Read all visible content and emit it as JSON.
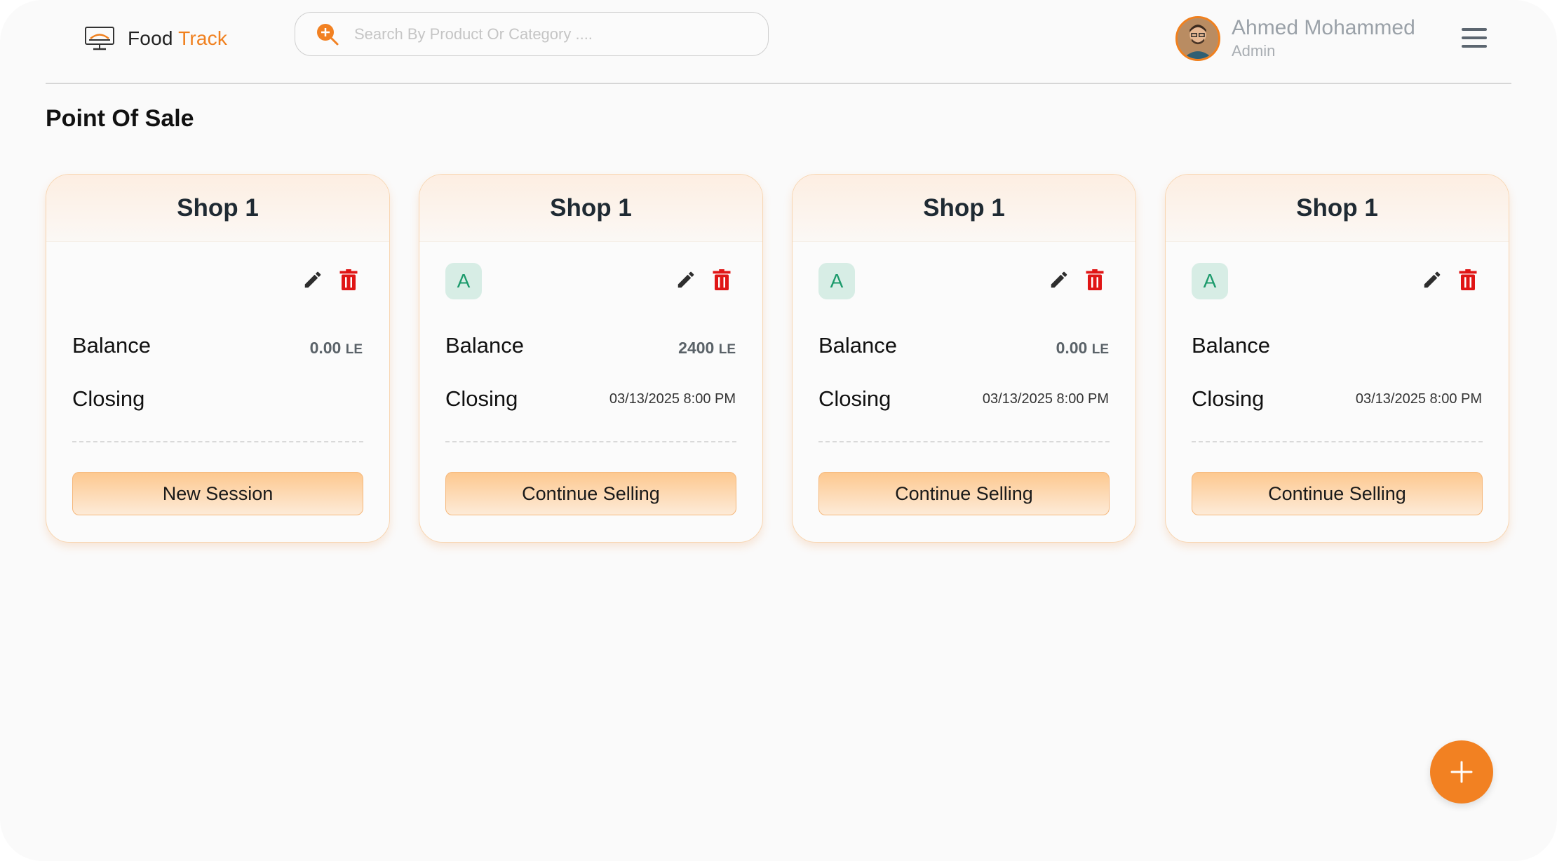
{
  "app": {
    "name_primary": "Food",
    "name_accent": "Track",
    "accent_color": "#f0801e"
  },
  "search": {
    "placeholder": "Search By Product Or Category ...."
  },
  "user": {
    "name": "Ahmed Mohammed",
    "role": "Admin"
  },
  "page": {
    "title": "Point Of Sale"
  },
  "shops": [
    {
      "title": "Shop 1",
      "badge": "",
      "balance_label": "Balance",
      "balance_value": "0.00",
      "balance_unit": "LE",
      "closing_label": "Closing",
      "closing_value": "",
      "action_label": "New Session"
    },
    {
      "title": "Shop 1",
      "badge": "A",
      "balance_label": "Balance",
      "balance_value": "2400",
      "balance_unit": "LE",
      "closing_label": "Closing",
      "closing_value": "03/13/2025 8:00 PM",
      "action_label": "Continue Selling"
    },
    {
      "title": "Shop 1",
      "badge": "A",
      "balance_label": "Balance",
      "balance_value": "0.00",
      "balance_unit": "LE",
      "closing_label": "Closing",
      "closing_value": "03/13/2025 8:00 PM",
      "action_label": "Continue Selling"
    },
    {
      "title": "Shop 1",
      "badge": "A",
      "balance_label": "Balance",
      "balance_value": "",
      "balance_unit": "",
      "closing_label": "Closing",
      "closing_value": "03/13/2025 8:00 PM",
      "action_label": "Continue Selling"
    }
  ],
  "icons": {
    "logo": "monitor-food-icon",
    "search": "search-icon",
    "edit": "pencil-icon",
    "delete": "trash-icon",
    "menu": "hamburger-icon",
    "add": "plus-icon"
  },
  "colors": {
    "delete": "#e01515",
    "badge_bg": "#d7ede5",
    "badge_text": "#1b9a6b",
    "fab": "#f28122"
  }
}
